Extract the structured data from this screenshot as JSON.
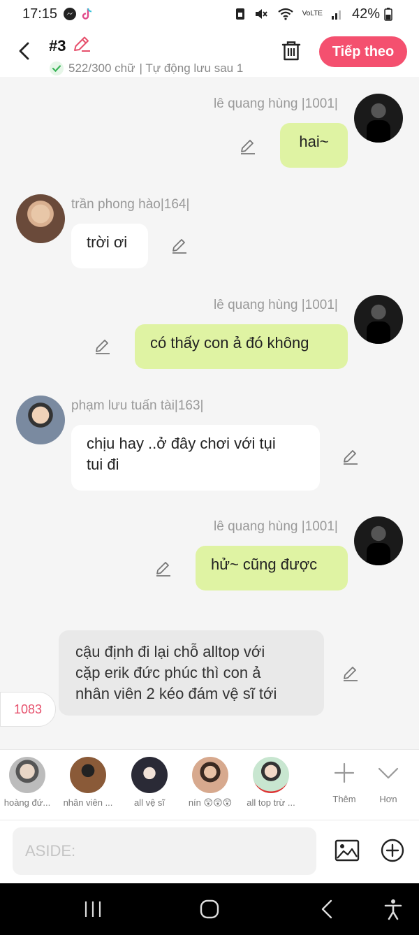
{
  "status_bar": {
    "time": "17:15",
    "network": "VoLTE",
    "battery": "42%"
  },
  "header": {
    "title": "#3",
    "word_count": "522/300 chữ",
    "autosave": "| Tự động lưu sau 1",
    "next_label": "Tiếp theo"
  },
  "messages": [
    {
      "sender": "lê quang hùng |1001|",
      "text": "hai~",
      "side": "right",
      "style": "green"
    },
    {
      "sender": "trần phong hào|164|",
      "text": "trời ơi",
      "side": "left",
      "style": "white"
    },
    {
      "sender": "lê quang hùng |1001|",
      "text": "có thấy con ả đó không",
      "side": "right",
      "style": "green"
    },
    {
      "sender": "phạm lưu tuấn tài|163|",
      "text_line1": "chịu hay ..ở đây chơi với tụi",
      "text_line2": "tui đi",
      "side": "left",
      "style": "white"
    },
    {
      "sender": "lê quang hùng |1001|",
      "text": "hử~ cũng được",
      "side": "right",
      "style": "green"
    },
    {
      "sender": "",
      "text_line1": "cậu định đi lại chỗ alltop với",
      "text_line2": "cặp erik đức phúc thì con ả",
      "text_line3": "nhân viên 2 kéo đám vệ sĩ tới",
      "side": "aside",
      "style": "gray"
    }
  ],
  "count_badge": "1083",
  "characters": [
    {
      "label": "hoàng đứ..."
    },
    {
      "label": "nhân viên ..."
    },
    {
      "label": "all vệ sĩ"
    },
    {
      "label": "nín 😲😲😲"
    },
    {
      "label": "all top trừ ..."
    }
  ],
  "strip_actions": {
    "more_label": "Thêm",
    "expand_label": "Hơn"
  },
  "input": {
    "placeholder": "ASIDE:"
  },
  "colors": {
    "accent": "#f4506f",
    "green_bubble": "#dff3a3",
    "aside_bubble": "#e9e9e9",
    "count": "#e6506c"
  }
}
